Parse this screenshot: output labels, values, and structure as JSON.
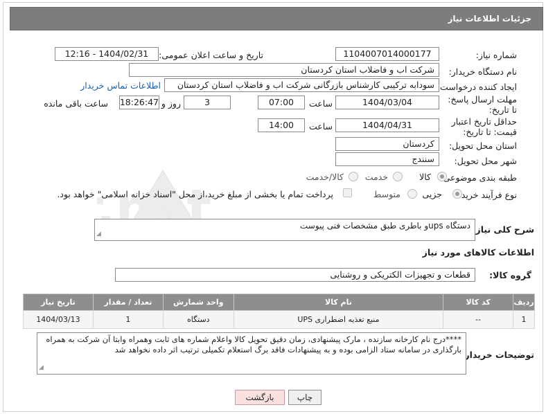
{
  "header": {
    "title": "جزئیات اطلاعات نیاز"
  },
  "fields": {
    "need_number_label": "شماره نیاز:",
    "need_number": "1104007014000177",
    "announce_label": "تاریخ و ساعت اعلان عمومی:",
    "announce_value": "1404/02/31 - 12:16",
    "buyer_label": "نام دستگاه خریدار:",
    "buyer_value": "شرکت اب و فاضلاب استان کردستان",
    "creator_label": "ایجاد کننده درخواست:",
    "creator_value": "سودابه ترکیبی کارشناس بازرگانی شرکت اب و فاضلاب استان کردستان",
    "contact_link": "اطلاعات تماس خریدار",
    "reply_deadline_label": "مهلت ارسال پاسخ: تا تاریخ:",
    "reply_date": "1404/03/04",
    "time_label": "ساعت",
    "reply_time": "07:00",
    "days_value": "3",
    "days_label": "روز و",
    "remaining_time": "18:26:47",
    "remaining_label": "ساعت باقی مانده",
    "price_validity_label": "حداقل تاریخ اعتبار قیمت: تا تاریخ:",
    "price_date": "1404/04/31",
    "price_time_label": "ساعت",
    "price_time": "14:00",
    "province_label": "استان محل تحویل:",
    "province_value": "کردستان",
    "city_label": "شهر محل تحویل:",
    "city_value": "سنندج",
    "category_label": "طبقه بندی موضوعی:",
    "category_options": [
      "کالا",
      "خدمت",
      "کالا/خدمت"
    ],
    "process_label": "نوع فرآیند خرید :",
    "process_options": [
      "جزیی",
      "متوسط"
    ],
    "payment_note": "پرداخت تمام یا بخشی از مبلغ خرید،از محل \"اسناد خزانه اسلامی\" خواهد بود."
  },
  "description": {
    "label": "شرح کلی نیاز:",
    "value": "دستگاه upsو باطری طبق مشخصات فنی پیوست"
  },
  "goods_info": {
    "heading": "اطلاعات کالاهای مورد نیاز",
    "group_label": "گروه کالا:",
    "group_value": "قطعات و تجهیزات الکتریکی و روشنایی"
  },
  "table": {
    "headers": [
      "ردیف",
      "کد کالا",
      "نام کالا",
      "واحد شمارش",
      "تعداد / مقدار",
      "تاریخ نیاز"
    ],
    "rows": [
      [
        "1",
        "--",
        "منبع تغذیه اضطراری UPS",
        "دستگاه",
        "1",
        "1404/03/13"
      ]
    ]
  },
  "buyer_notes": {
    "label": "توضیحات خریدار:",
    "value": "****درج نام کارخانه سازنده ، مارک پیشنهادی، زمان دقیق تحویل کالا واعلام شماره های ثابت وهمراه وابتا آن شرکت به همراه بارگذاری در سامانه ستاد الزامی بوده و به پیشنهادات فاقد برگ استعلام تکمیلی ترتیب اثر داده نخواهد شد"
  },
  "buttons": {
    "print": "چاپ",
    "back": "بازگشت"
  },
  "watermark_text": "AriaTender.net"
}
